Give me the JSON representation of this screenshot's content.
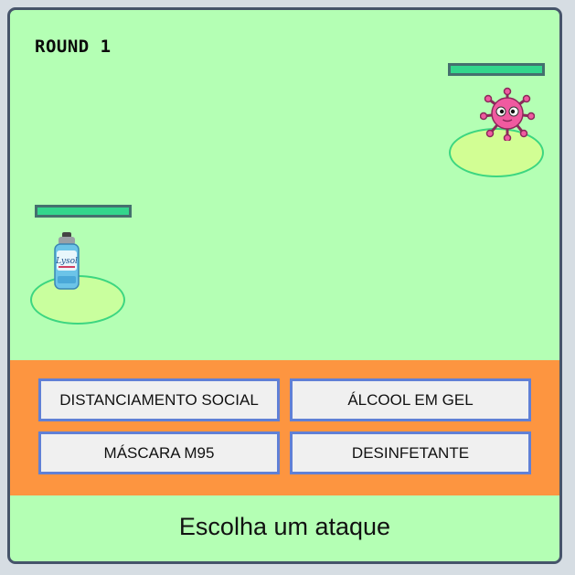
{
  "game": {
    "round_label": "ROUND 1"
  },
  "enemy": {
    "name": "virus",
    "icon": "virus-icon",
    "hp_fraction": 1.0
  },
  "player": {
    "name": "disinfectant-spray",
    "icon": "spray-can-icon",
    "hp_fraction": 1.0,
    "can_label": "Lysol"
  },
  "attacks": [
    {
      "label": "DISTANCIAMENTO SOCIAL"
    },
    {
      "label": "ÁLCOOL EM GEL"
    },
    {
      "label": "MÁSCARA M95"
    },
    {
      "label": "DESINFETANTE"
    }
  ],
  "message": "Escolha um ataque",
  "colors": {
    "background": "#b4ffb4",
    "panel": "#fd9540",
    "hp_fill": "#33d68c",
    "button_border": "#6080d6",
    "virus": "#f05aa0"
  }
}
